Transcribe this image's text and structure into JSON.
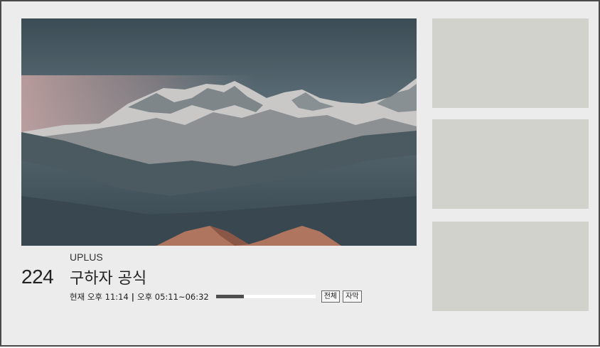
{
  "channel": {
    "number": "224",
    "provider": "UPLUS",
    "title": "구하자 공식"
  },
  "schedule": {
    "now_label": "현재 오후 11:14",
    "separator": "|",
    "time_range": "오후 05:11~06:32",
    "progress": 0.28
  },
  "badges": {
    "all": "전체",
    "subtitles": "자막"
  },
  "thumbnails": [
    {
      "id": "thumb-1"
    },
    {
      "id": "thumb-2"
    },
    {
      "id": "thumb-3"
    }
  ],
  "colors": {
    "background": "#ececec",
    "thumbnail": "#d1d2cc",
    "progress_fill": "#4f4f4f",
    "progress_track": "#ffffff"
  }
}
